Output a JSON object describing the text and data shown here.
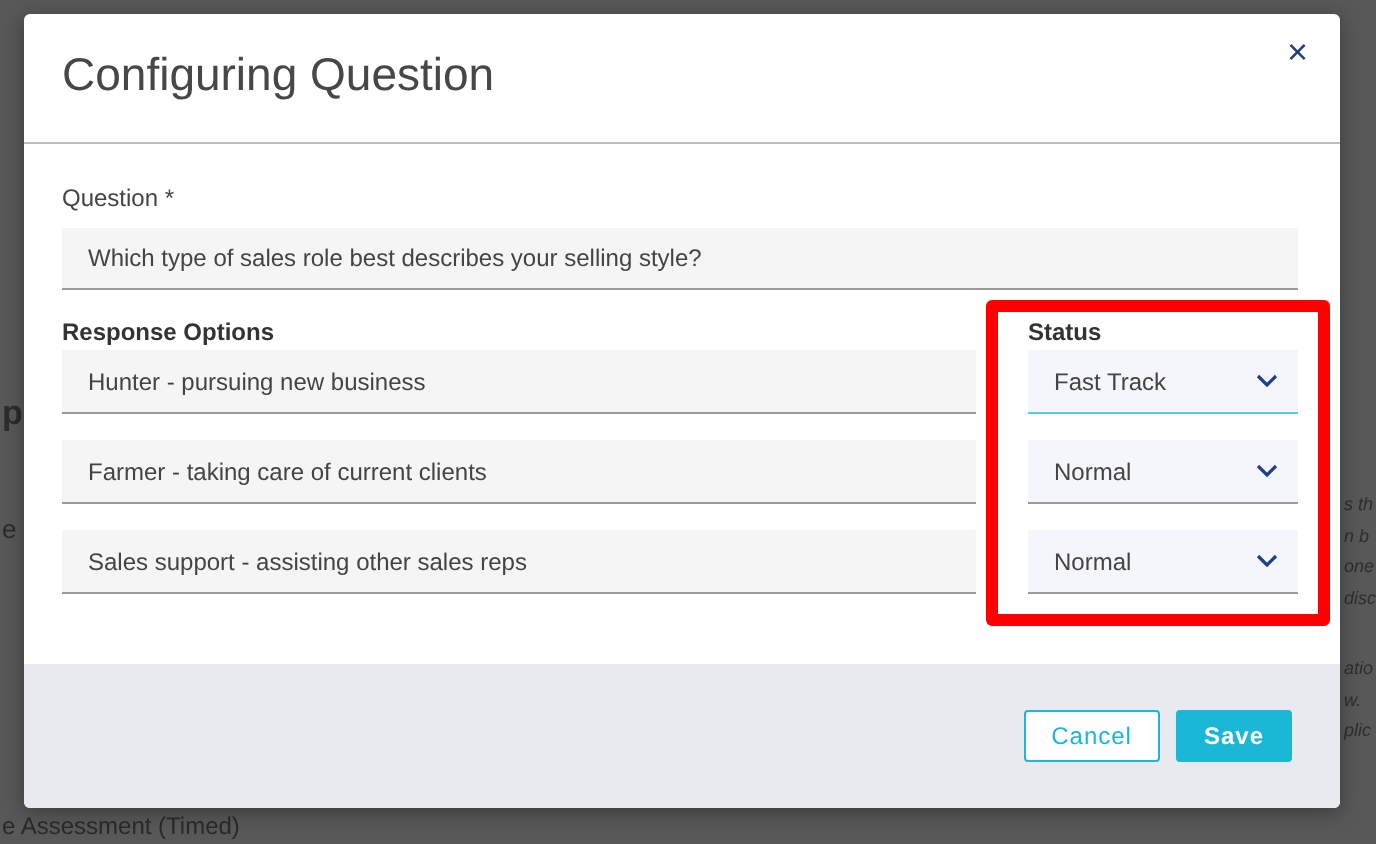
{
  "background": {
    "left_texts": [
      {
        "text": "p",
        "kind": "heading"
      },
      {
        "text": "e",
        "kind": "body"
      }
    ],
    "right_texts": [
      "s th",
      "n b",
      "one",
      "disc",
      "atio",
      "w.",
      "plic"
    ],
    "bottom_text": "e Assessment (Timed)"
  },
  "dialog": {
    "title": "Configuring Question",
    "close": "×",
    "question": {
      "label": "Question *",
      "value": "Which type of sales role best describes your selling style?"
    },
    "options_heading": "Response Options",
    "status_heading": "Status",
    "options": [
      {
        "response": "Hunter - pursuing new business",
        "status": "Fast Track",
        "focused": true
      },
      {
        "response": "Farmer - taking care of current clients",
        "status": "Normal",
        "focused": false
      },
      {
        "response": "Sales support - assisting other sales reps",
        "status": "Normal",
        "focused": false
      }
    ],
    "buttons": [
      {
        "label": "Cancel",
        "kind": "secondary"
      },
      {
        "label": "Save",
        "kind": "primary"
      }
    ]
  }
}
